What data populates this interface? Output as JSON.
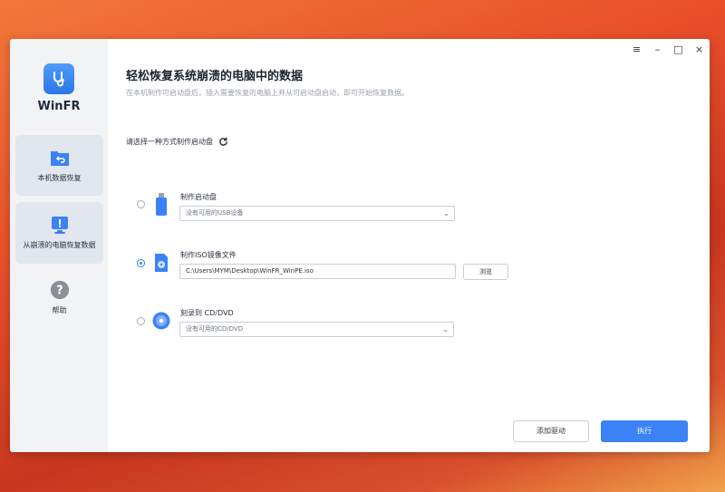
{
  "app": {
    "name": "WinFR"
  },
  "sidebar": {
    "items": [
      {
        "label": "本机数据恢复",
        "icon": "folder-restore-icon"
      },
      {
        "label": "从崩溃的电脑恢复数据",
        "icon": "crashed-pc-icon"
      },
      {
        "label": "帮助",
        "icon": "help-icon"
      }
    ]
  },
  "window_controls": {
    "menu": "≡",
    "minimize": "–",
    "maximize": "□",
    "close": "×"
  },
  "main": {
    "title": "轻松恢复系统崩溃的电脑中的数据",
    "subtitle": "在本机制作可启动盘后，插入需要恢复的电脑上并从可启动盘启动，即可开始恢复数据。",
    "choose_label": "请选择一种方式制作启动盘"
  },
  "options": {
    "usb": {
      "label": "制作启动盘",
      "select_value": "没有可用的USB设备",
      "selected": false
    },
    "iso": {
      "label": "制作ISO镜像文件",
      "path_value": "C:\\Users\\MYM\\Desktop\\WinFR_WinPE.iso",
      "browse_label": "浏览",
      "selected": true
    },
    "cd": {
      "label": "刻录到 CD/DVD",
      "select_value": "没有可用的CD/DVD",
      "selected": false
    }
  },
  "footer": {
    "add_driver_label": "添加驱动",
    "execute_label": "执行"
  },
  "colors": {
    "accent": "#3b82f6",
    "sidebar_bg": "#f2f3f5",
    "desktop": "#e8502a"
  }
}
